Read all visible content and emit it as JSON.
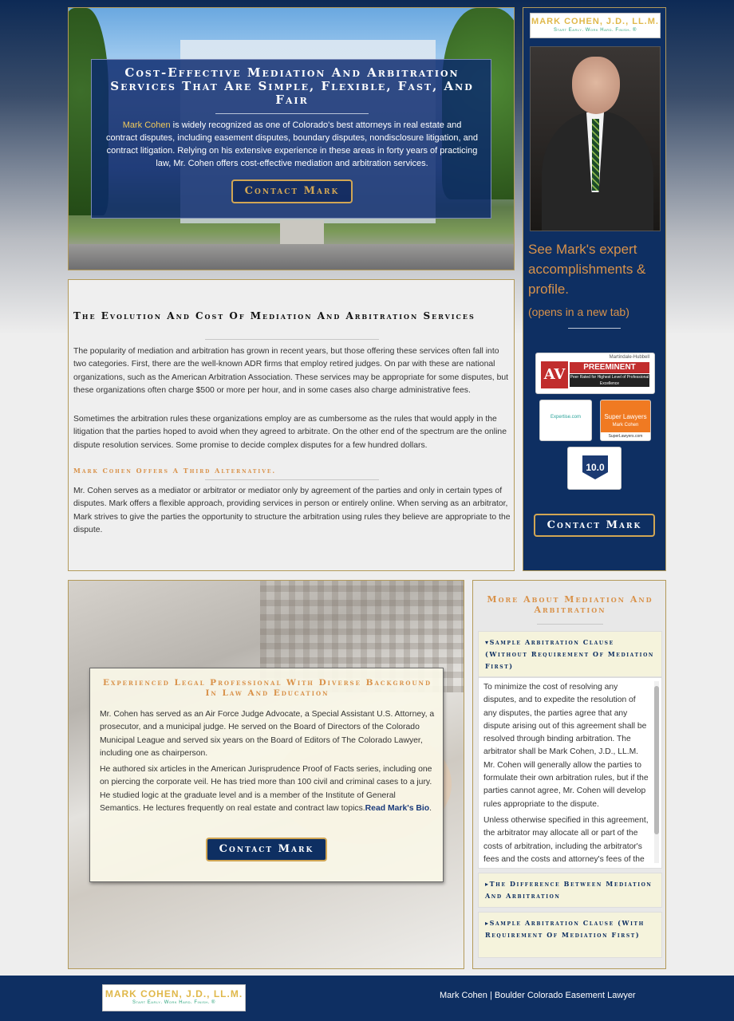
{
  "hero": {
    "title": "Cost-Effective Mediation And Arbitration Services That Are Simple, Flexible, Fast, And Fair",
    "highlight_name": "Mark Cohen",
    "text": " is widely recognized as one of Colorado's best attorneys in real estate and contract disputes, including easement disputes, boundary disputes, nondisclosure litigation, and contract litigation. Relying on his extensive experience in these areas in forty years of practicing law, Mr. Cohen offers cost-effective mediation and arbitration services.",
    "button": "Contact Mark"
  },
  "sidebar": {
    "logo_name": "MARK COHEN, J.D., LL.M.",
    "logo_tagline": "Start Early. Work Hard. Finish. ®",
    "profile_link": "See Mark's expert accomplishments & profile.",
    "new_tab": "(opens in a new tab)",
    "badges": {
      "av_org": "Martindale-Hubbell",
      "av_letters": "AV",
      "av_title": "PREEMINENT",
      "av_sub": "Peer Rated for Highest Level of Professional Excellence",
      "expertise": "Expertise.com",
      "superlawyers": "Super Lawyers",
      "superlawyers_name": "Mark Cohen",
      "superlawyers_url": "SuperLawyers.com",
      "avvo": "10.0"
    },
    "button": "Contact Mark"
  },
  "article": {
    "title": "The Evolution And Cost Of Mediation And Arbitration Services",
    "p1": "The popularity of mediation and arbitration has grown in recent years, but those offering these services often fall into two categories. First, there are the well-known ADR firms that employ retired judges. On par with these are national organizations, such as the American Arbitration Association. These services may be appropriate for some disputes, but these organizations often charge $500 or more per hour, and in some cases also charge administrative fees.",
    "p2": "Sometimes the arbitration rules these organizations employ are as cumbersome as the rules that would apply in the litigation that the parties hoped to avoid when they agreed to arbitrate. On the other end of the spectrum are the online dispute resolution services. Some promise to decide complex disputes for a few hundred dollars.",
    "subtitle": "Mark Cohen Offers A Third Alternative.",
    "p3": "Mr. Cohen serves as a mediator or arbitrator or mediator only by agreement of the parties and only in certain types of disputes. Mark offers a flexible approach, providing services in person or entirely online. When serving as an arbitrator, Mark strives to give the parties the opportunity to structure the arbitration using rules they believe are appropriate to the dispute."
  },
  "bio": {
    "title": "Experienced Legal Professional With Diverse Background In Law And Education",
    "p1": "Mr. Cohen has served as an Air Force Judge Advocate, a Special Assistant U.S. Attorney, a prosecutor, and a municipal judge. He served on the Board of Directors of the Colorado Municipal League and served six years on the Board of Editors of The Colorado Lawyer, including one as chairperson.",
    "p2": "He authored six articles in the American Jurisprudence Proof of Facts series, including one on piercing the corporate veil. He has tried more than 100 civil and criminal cases to a jury. He studied logic at the graduate level and is a member of the Institute of General Semantics. He lectures frequently on real estate and contract law topics.",
    "link": "Read Mark's Bio",
    "link_end": ".",
    "button": "Contact Mark"
  },
  "more": {
    "title": "More About Mediation And Arbitration",
    "acc1": "▾Sample Arbitration Clause (Without Requirement Of Mediation First)",
    "acc1_p1": "To minimize the cost of resolving any disputes, and to expedite the resolution of any disputes, the parties agree that any dispute arising out of this agreement shall be resolved through binding arbitration. The arbitrator shall be Mark Cohen, J.D., LL.M. Mr. Cohen will generally allow the parties to formulate their own arbitration rules, but if the parties cannot agree, Mr. Cohen will develop rules appropriate to the dispute.",
    "acc1_p2": "Unless otherwise specified in this agreement, the arbitrator may allocate all or part of the costs of arbitration, including the arbitrator's fees and the costs and attorney's fees of the prevailing party, if the",
    "acc2": "▸The Difference Between Mediation And Arbitration",
    "acc3": "▸Sample Arbitration Clause (With Requirement Of Mediation First)"
  },
  "footer": {
    "logo_name": "MARK COHEN, J.D., LL.M.",
    "logo_tagline": "Start Early. Work Hard. Finish. ®",
    "text": "Mark Cohen | Boulder Colorado Easement Lawyer"
  }
}
